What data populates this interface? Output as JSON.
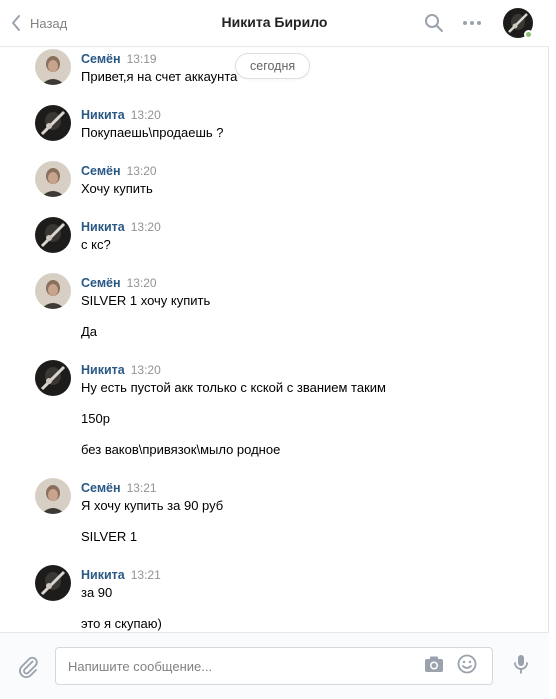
{
  "header": {
    "back_label": "Назад",
    "title": "Никита Бирило"
  },
  "date_divider": "сегодня",
  "messages": [
    {
      "author": "Семён",
      "time": "13:19",
      "lines": [
        "Привет,я на счет аккаунта"
      ]
    },
    {
      "author": "Никита",
      "time": "13:20",
      "lines": [
        "Покупаешь\\продаешь ?"
      ]
    },
    {
      "author": "Семён",
      "time": "13:20",
      "lines": [
        "Хочу купить"
      ]
    },
    {
      "author": "Никита",
      "time": "13:20",
      "lines": [
        "с кс?"
      ]
    },
    {
      "author": "Семён",
      "time": "13:20",
      "lines": [
        "SILVER 1 хочу купить",
        "Да"
      ]
    },
    {
      "author": "Никита",
      "time": "13:20",
      "lines": [
        "Ну есть пустой акк только с кской с званием таким",
        "150р",
        "без ваков\\привязок\\мыло родное"
      ]
    },
    {
      "author": "Семён",
      "time": "13:21",
      "lines": [
        "Я хочу купить за 90 руб",
        "SILVER 1"
      ]
    },
    {
      "author": "Никита",
      "time": "13:21",
      "lines": [
        "за 90",
        "это я скупаю)"
      ]
    }
  ],
  "composer": {
    "placeholder": "Напишите сообщение..."
  },
  "colors": {
    "author_link": "#2a5885",
    "online": "#8ac176"
  }
}
